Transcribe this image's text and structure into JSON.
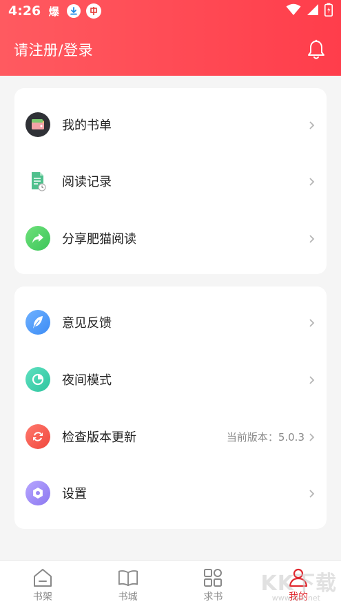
{
  "status_bar": {
    "time": "4:26",
    "app_glyph": "爆"
  },
  "header": {
    "title": "请注册/登录",
    "bell": "bell-icon"
  },
  "colors": {
    "header_start": "#ff5a60",
    "header_end": "#ff3d4b",
    "active_nav": "#e0282f"
  },
  "section1": [
    {
      "label": "我的书单",
      "icon": "wallet-icon"
    },
    {
      "label": "阅读记录",
      "icon": "reading-history-icon"
    },
    {
      "label": "分享肥猫阅读",
      "icon": "share-icon"
    }
  ],
  "section2": [
    {
      "label": "意见反馈",
      "icon": "feather-icon"
    },
    {
      "label": "夜间模式",
      "icon": "night-mode-icon"
    },
    {
      "label": "检查版本更新",
      "icon": "refresh-icon",
      "value": "当前版本：5.0.3"
    },
    {
      "label": "设置",
      "icon": "settings-icon"
    }
  ],
  "bottom_nav": [
    {
      "label": "书架",
      "icon": "home-icon"
    },
    {
      "label": "书城",
      "icon": "book-icon"
    },
    {
      "label": "求书",
      "icon": "grid-icon"
    },
    {
      "label": "我的",
      "icon": "user-icon",
      "active": true
    }
  ],
  "watermark": {
    "text": "KK下载",
    "sub": "www.kkx.net"
  }
}
